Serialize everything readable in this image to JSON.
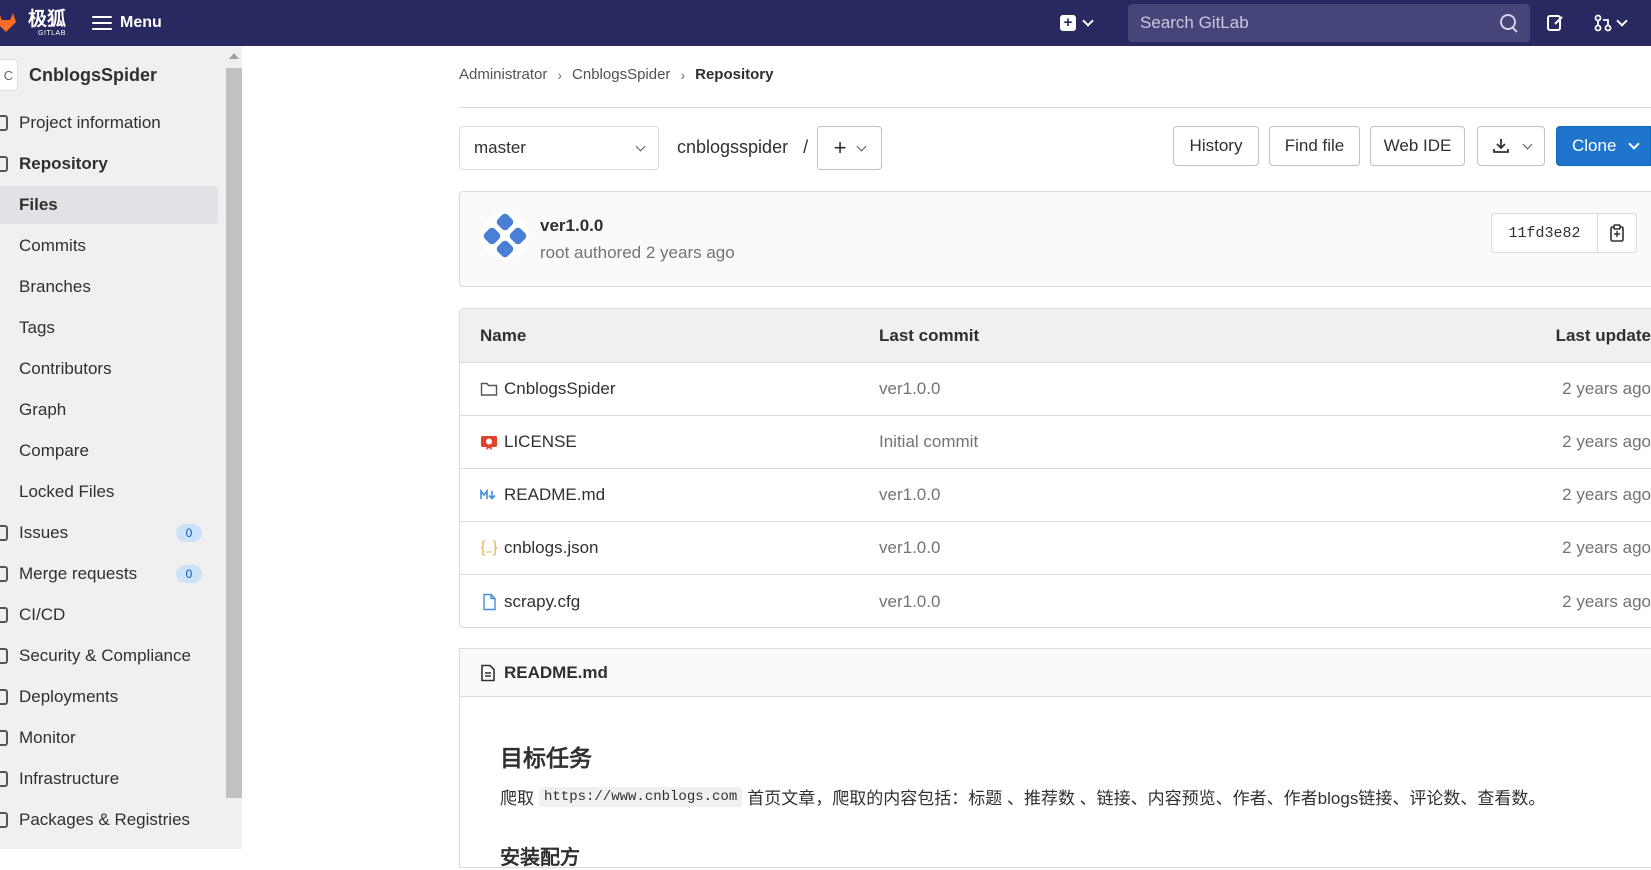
{
  "topbar": {
    "logo_text": "极狐",
    "logo_sub": "GITLAB",
    "menu_label": "Menu",
    "search_placeholder": "Search GitLab"
  },
  "sidebar": {
    "project_initial": "C",
    "project_name": "CnblogsSpider",
    "items": [
      {
        "label": "Project information"
      },
      {
        "label": "Repository"
      },
      {
        "label": "Files"
      },
      {
        "label": "Commits"
      },
      {
        "label": "Branches"
      },
      {
        "label": "Tags"
      },
      {
        "label": "Contributors"
      },
      {
        "label": "Graph"
      },
      {
        "label": "Compare"
      },
      {
        "label": "Locked Files"
      },
      {
        "label": "Issues",
        "badge": "0"
      },
      {
        "label": "Merge requests",
        "badge": "0"
      },
      {
        "label": "CI/CD"
      },
      {
        "label": "Security & Compliance"
      },
      {
        "label": "Deployments"
      },
      {
        "label": "Monitor"
      },
      {
        "label": "Infrastructure"
      },
      {
        "label": "Packages & Registries"
      }
    ]
  },
  "breadcrumb": {
    "items": [
      "Administrator",
      "CnblogsSpider",
      "Repository"
    ]
  },
  "toolbar": {
    "branch": "master",
    "path": "cnblogsspider",
    "path_sep": "/",
    "history": "History",
    "find_file": "Find file",
    "web_ide": "Web IDE",
    "clone": "Clone"
  },
  "commit": {
    "title": "ver1.0.0",
    "meta": "root authored 2 years ago",
    "sha": "11fd3e82"
  },
  "tree": {
    "headers": {
      "name": "Name",
      "last_commit": "Last commit",
      "last_update": "Last update"
    },
    "rows": [
      {
        "name": "CnblogsSpider",
        "commit": "ver1.0.0",
        "date": "2 years ago",
        "icon": "folder-icon"
      },
      {
        "name": "LICENSE",
        "commit": "Initial commit",
        "date": "2 years ago",
        "icon": "license-icon"
      },
      {
        "name": "README.md",
        "commit": "ver1.0.0",
        "date": "2 years ago",
        "icon": "markdown-icon"
      },
      {
        "name": "cnblogs.json",
        "commit": "ver1.0.0",
        "date": "2 years ago",
        "icon": "json-icon"
      },
      {
        "name": "scrapy.cfg",
        "commit": "ver1.0.0",
        "date": "2 years ago",
        "icon": "file-icon"
      }
    ]
  },
  "readme": {
    "filename": "README.md",
    "heading": "目标任务",
    "para_prefix": "爬取",
    "para_code": "https://www.cnblogs.com",
    "para_suffix": "首页文章，爬取的内容包括：标题 、推荐数 、链接、内容预览、作者、作者blogs链接、评论数、查看数。",
    "heading2": "安装配方"
  },
  "colors": {
    "topbar": "#292961",
    "primary": "#1f75cb",
    "sidebar_bg": "#f0f0f0"
  }
}
